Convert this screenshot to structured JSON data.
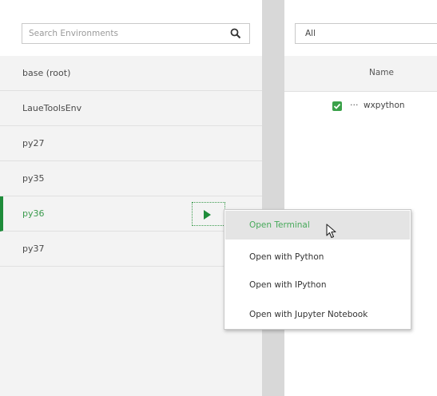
{
  "search": {
    "placeholder": "Search Environments"
  },
  "environments": [
    {
      "label": "base (root)"
    },
    {
      "label": "LaueToolsEnv"
    },
    {
      "label": "py27"
    },
    {
      "label": "py35"
    },
    {
      "label": "py36"
    },
    {
      "label": "py37"
    }
  ],
  "active_environment": "py36",
  "filter": {
    "selected": "All"
  },
  "packages": {
    "column_name": "Name",
    "rows": [
      {
        "ellipsis": "...",
        "name": "wxpython",
        "checked": true
      }
    ]
  },
  "context_menu": {
    "items": [
      {
        "label": "Open Terminal"
      },
      {
        "label": "Open with Python"
      },
      {
        "label": "Open with IPython"
      },
      {
        "label": "Open with Jupyter Notebook"
      }
    ],
    "hovered": "Open Terminal"
  },
  "colors": {
    "accent": "#1e8c3a",
    "accent_text": "#47a95a",
    "panel_bg": "#f3f3f3",
    "divider": "#d8d8d8"
  },
  "icons": {
    "search": "search-icon",
    "play": "play-icon",
    "checkbox": "checkbox-checked-icon",
    "cursor": "mouse-pointer-icon"
  }
}
